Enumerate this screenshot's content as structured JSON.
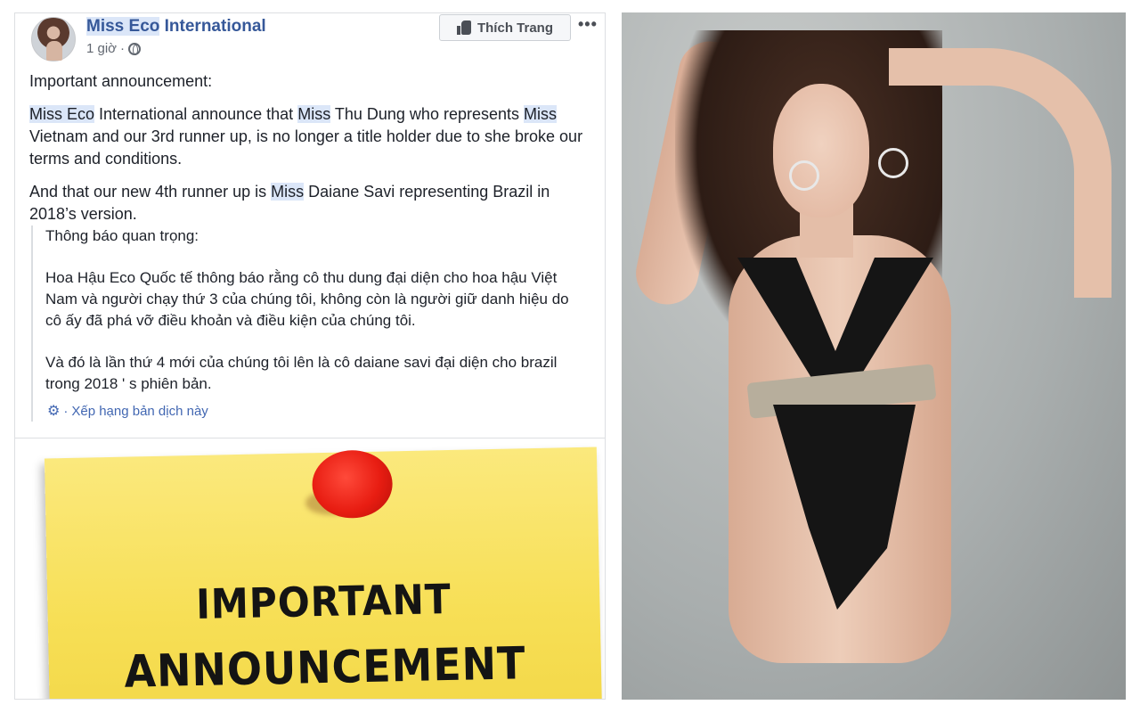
{
  "post": {
    "page_name_part1": "Miss Eco",
    "page_name_part2": " International",
    "time": "1 giờ",
    "time_separator": "·",
    "like_button_label": "Thích Trang",
    "more_label": "•••",
    "body": {
      "p1": "Important announcement:",
      "p2": {
        "s1": "Miss Eco",
        "s2": " International announce that ",
        "s3": "Miss",
        "s4": " Thu Dung who represents ",
        "s5": "Miss",
        "s6": " Vietnam and our 3rd runner up, is no longer a title holder due to she broke our terms and conditions."
      },
      "p3": {
        "s1": "And that our new 4th runner up is ",
        "s2": "Miss",
        "s3": " Daiane Savi representing Brazil in 2018’s version."
      }
    },
    "translation": {
      "p1": "Thông báo quan trọng:",
      "p2": "Hoa Hậu Eco Quốc tế thông báo rằng cô thu dung đại diện cho hoa hậu Việt Nam và người chạy thứ 3 của chúng tôi, không còn là người giữ danh hiệu do cô ấy đã phá vỡ điều khoản và điều kiện của chúng tôi.",
      "p3": "Và đó là lần thứ 4 mới của chúng tôi lên là cô daiane savi đại diện cho brazil trong 2018 ' s phiên bản.",
      "rate_label": "Xếp hạng bản dịch này",
      "rate_separator": "·"
    },
    "note_image": {
      "line1": "IMPORTANT",
      "line2": "ANNOUNCEMENT"
    },
    "colors": {
      "link": "#365899",
      "highlight": "#dbe6f8",
      "note_yellow": "#f7df56",
      "pin_red": "#e81d12"
    },
    "icons": [
      "thumbs-up-icon",
      "globe-icon",
      "gear-icon",
      "more-icon"
    ]
  }
}
